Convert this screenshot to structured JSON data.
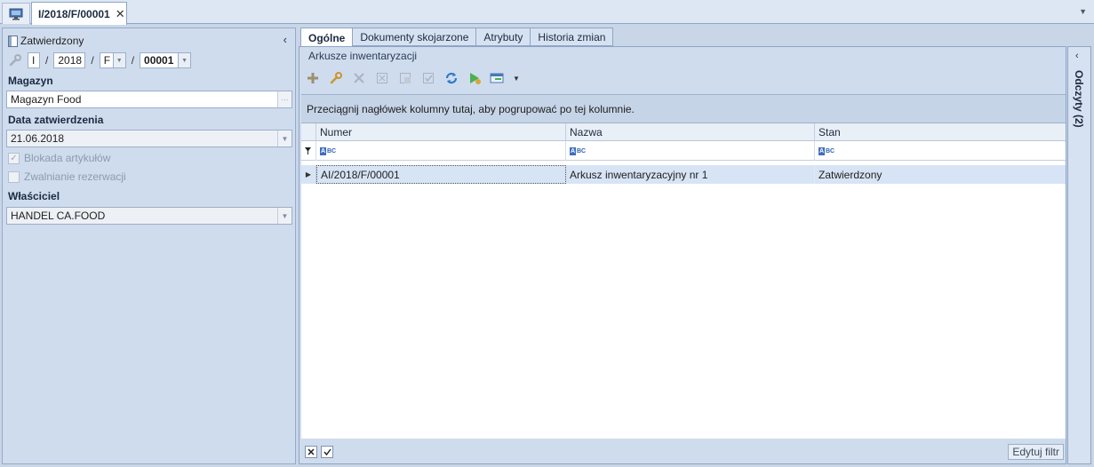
{
  "top_tabs": {
    "document": "I/2018/F/00001",
    "close": "✕"
  },
  "header": {
    "status": "Zatwierdzony",
    "number_parts": [
      "I",
      "/",
      "2018",
      "/",
      "F",
      "/",
      "00001"
    ]
  },
  "form": {
    "warehouse_label": "Magazyn",
    "warehouse_value": "Magazyn Food",
    "approval_date_label": "Data zatwierdzenia",
    "approval_date_value": "21.06.2018",
    "block_items_label": "Blokada artykułów",
    "block_items_checked": true,
    "release_reservations_label": "Zwalnianie rezerwacji",
    "release_reservations_checked": false,
    "owner_label": "Właściciel",
    "owner_value": "HANDEL CA.FOOD"
  },
  "tabs": [
    "Ogólne",
    "Dokumenty skojarzone",
    "Atrybuty",
    "Historia zmian"
  ],
  "section_title": "Arkusze inwentaryzacji",
  "group_hint": "Przeciągnij nagłówek kolumny tutaj, aby pogrupować po tej kolumnie.",
  "grid": {
    "columns": [
      "Numer",
      "Nazwa",
      "Stan"
    ],
    "rows": [
      [
        "AI/2018/F/00001",
        "Arkusz inwentaryzacyjny nr 1",
        "Zatwierdzony"
      ]
    ]
  },
  "footer": {
    "edit_filter": "Edytuj filtr"
  },
  "side_panel": {
    "label": "Odczyty (2)"
  },
  "colors": {
    "accent": "#3f6ec0",
    "selected_row": "#d7e4f5",
    "panel_bg": "#cfdcee"
  }
}
